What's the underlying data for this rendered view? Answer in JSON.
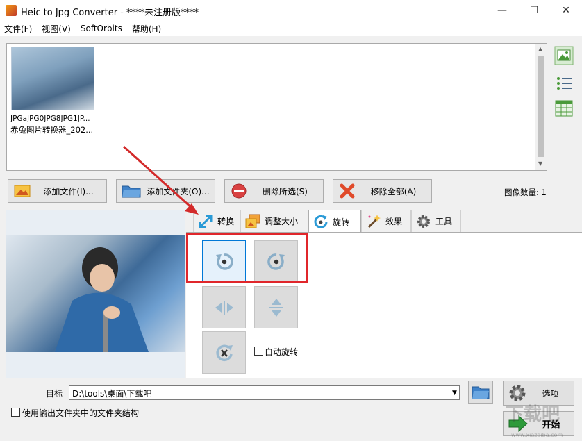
{
  "window": {
    "title": "Heic to Jpg Converter - ****未注册版****",
    "minimize": "—",
    "maximize": "☐",
    "close": "✕"
  },
  "menu": [
    "文件(F)",
    "视图(V)",
    "SoftOrbits",
    "帮助(H)"
  ],
  "file_list": {
    "items": [
      {
        "name_line1": "JPGaJPG0JPG8JPG1JP...",
        "name_line2": "赤兔图片转换器_202..."
      }
    ]
  },
  "toolbar": {
    "add_files": "添加文件(I)...",
    "add_folder": "添加文件夹(O)...",
    "remove_selected": "删除所选(S)",
    "remove_all": "移除全部(A)",
    "image_count": "图像数量: 1"
  },
  "tabs": [
    {
      "label": "转换",
      "icon": "convert-arrow-icon"
    },
    {
      "label": "调整大小",
      "icon": "resize-icon"
    },
    {
      "label": "旋转",
      "icon": "rotate-icon",
      "active": true
    },
    {
      "label": "效果",
      "icon": "magic-wand-icon"
    },
    {
      "label": "工具",
      "icon": "gear-icon"
    }
  ],
  "rotate": {
    "auto_rotate_label": "自动旋转",
    "auto_rotate_checked": false
  },
  "output": {
    "target_label": "目标",
    "target_path": "D:\\tools\\桌面\\下载吧",
    "keep_structure_label": "使用输出文件夹中的文件夹结构",
    "options_label": "选项",
    "start_label": "开始"
  },
  "watermark": {
    "line1": "下载吧",
    "line2": "www.xiazaiba.com"
  },
  "colors": {
    "accent": "#0078d7",
    "highlight": "#e0262b",
    "arrow": "#d32a2a"
  }
}
